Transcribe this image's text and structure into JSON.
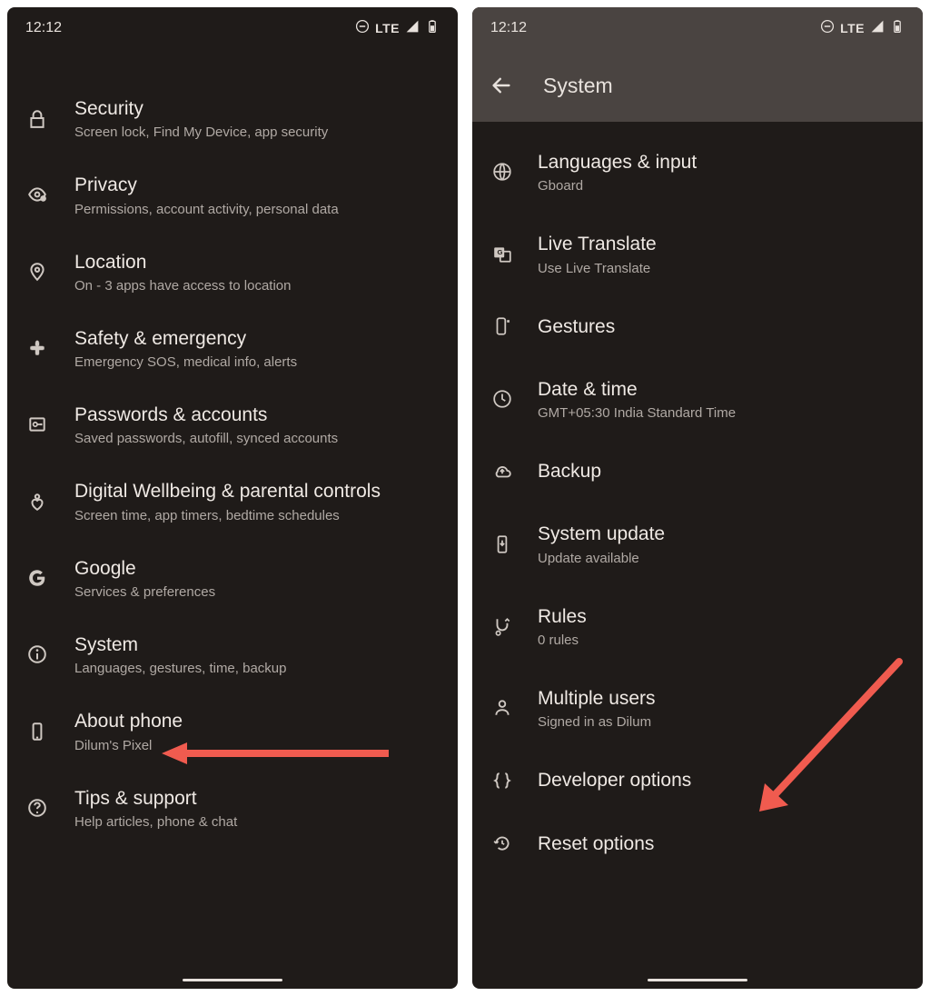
{
  "status": {
    "time": "12:12",
    "net": "LTE"
  },
  "left": {
    "items": [
      {
        "icon": "lock",
        "title": "Security",
        "sub": "Screen lock, Find My Device, app security"
      },
      {
        "icon": "eye",
        "title": "Privacy",
        "sub": "Permissions, account activity, personal data"
      },
      {
        "icon": "pin",
        "title": "Location",
        "sub": "On - 3 apps have access to location"
      },
      {
        "icon": "medical",
        "title": "Safety & emergency",
        "sub": "Emergency SOS, medical info, alerts"
      },
      {
        "icon": "key",
        "title": "Passwords & accounts",
        "sub": "Saved passwords, autofill, synced accounts"
      },
      {
        "icon": "wellbeing",
        "title": "Digital Wellbeing & parental controls",
        "sub": "Screen time, app timers, bedtime schedules"
      },
      {
        "icon": "google",
        "title": "Google",
        "sub": "Services & preferences"
      },
      {
        "icon": "info",
        "title": "System",
        "sub": "Languages, gestures, time, backup"
      },
      {
        "icon": "phone",
        "title": "About phone",
        "sub": "Dilum's Pixel"
      },
      {
        "icon": "help",
        "title": "Tips & support",
        "sub": "Help articles, phone & chat"
      }
    ]
  },
  "right": {
    "header": "System",
    "items": [
      {
        "icon": "globe",
        "title": "Languages & input",
        "sub": "Gboard"
      },
      {
        "icon": "translate",
        "title": "Live Translate",
        "sub": "Use Live Translate"
      },
      {
        "icon": "gesture",
        "title": "Gestures",
        "sub": null
      },
      {
        "icon": "clock",
        "title": "Date & time",
        "sub": "GMT+05:30 India Standard Time"
      },
      {
        "icon": "cloud",
        "title": "Backup",
        "sub": null
      },
      {
        "icon": "update",
        "title": "System update",
        "sub": "Update available"
      },
      {
        "icon": "rules",
        "title": "Rules",
        "sub": "0 rules"
      },
      {
        "icon": "users",
        "title": "Multiple users",
        "sub": "Signed in as Dilum"
      },
      {
        "icon": "braces",
        "title": "Developer options",
        "sub": null
      },
      {
        "icon": "reset",
        "title": "Reset options",
        "sub": null
      }
    ]
  }
}
